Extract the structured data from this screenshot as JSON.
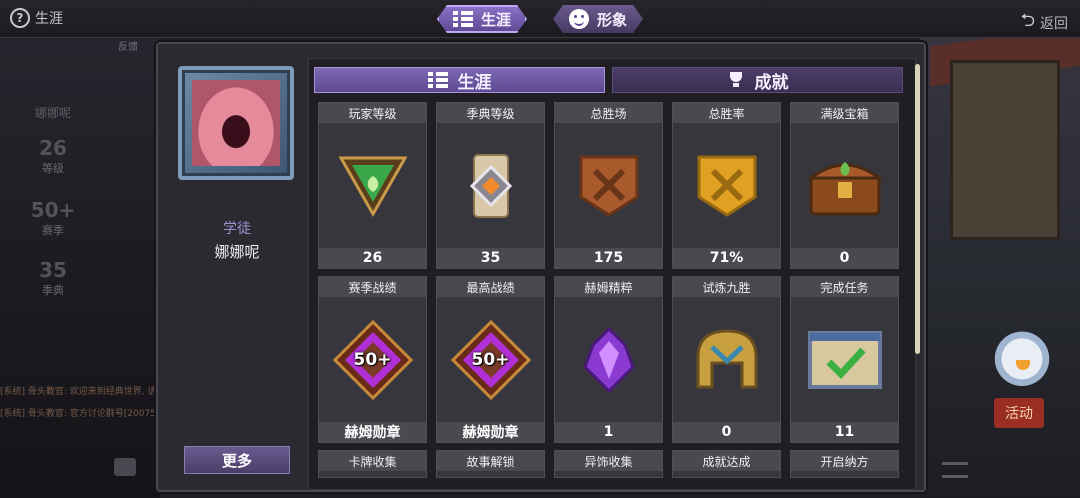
{
  "topbar": {
    "career_label": "生涯",
    "tabs": [
      {
        "label": "生涯",
        "icon": "list-icon",
        "active": true
      },
      {
        "label": "形象",
        "icon": "smile-icon",
        "active": false
      }
    ],
    "back_label": "返回"
  },
  "background": {
    "feedback_label": "反馈",
    "rank_label": "学徒",
    "name": "娜娜呢",
    "level_num": "26",
    "level_label": "等级",
    "season_num": "50+",
    "season_label": "赛季",
    "classic_num": "35",
    "classic_label": "季典",
    "chat_lines": [
      "[系统] 骨头教官: 欢迎来到经典世界, 请",
      "[系统] 骨头教官: 官方讨论群号[20075"
    ],
    "activity_label": "活动"
  },
  "profile": {
    "rank": "学徒",
    "name": "娜娜呢",
    "more_label": "更多"
  },
  "content_tabs": [
    {
      "label": "生涯",
      "icon": "list-icon",
      "active": true
    },
    {
      "label": "成就",
      "icon": "trophy-icon",
      "active": false
    }
  ],
  "cards": [
    {
      "title": "玩家等级",
      "value": "26",
      "icon": "green-triangle-emblem-icon"
    },
    {
      "title": "季典等级",
      "value": "35",
      "icon": "scroll-diamond-emblem-icon"
    },
    {
      "title": "总胜场",
      "value": "175",
      "icon": "bronze-crossed-swords-shield-icon"
    },
    {
      "title": "总胜率",
      "value": "71%",
      "icon": "gold-crossed-swords-shield-icon"
    },
    {
      "title": "满级宝箱",
      "value": "0",
      "icon": "treasure-chest-icon"
    },
    {
      "title": "赛季战绩",
      "value": "赫姆勋章",
      "badge": "50+",
      "icon": "purple-medal-icon"
    },
    {
      "title": "最高战绩",
      "value": "赫姆勋章",
      "badge": "50+",
      "icon": "purple-medal-icon"
    },
    {
      "title": "赫姆精粹",
      "value": "1",
      "icon": "purple-crystal-icon"
    },
    {
      "title": "试炼九胜",
      "value": "0",
      "icon": "golden-helmet-icon"
    },
    {
      "title": "完成任务",
      "value": "11",
      "icon": "checkmark-board-icon"
    }
  ],
  "partial_cards": [
    "卡牌收集",
    "故事解锁",
    "异饰收集",
    "成就达成",
    "开启纳方"
  ],
  "colors": {
    "accent_purple": "#7d68b3",
    "panel_bg": "#2b2a30",
    "card_bg": "#37363d"
  }
}
